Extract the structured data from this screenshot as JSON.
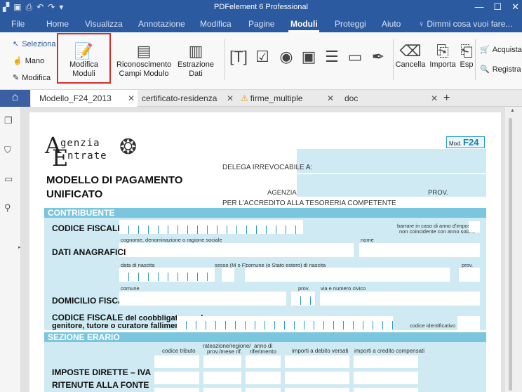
{
  "app": {
    "title": "PDFelement 6 Professional"
  },
  "menu": {
    "items": [
      "File",
      "Home",
      "Visualizza",
      "Annotazione",
      "Modifica",
      "Pagine",
      "Moduli",
      "Proteggi",
      "Aiuto"
    ],
    "tell_me": "Dimmi cosa vuoi fare..."
  },
  "ribbon": {
    "seleziona": "Seleziona",
    "mano": "Mano",
    "modifica": "Modifica",
    "modifica_moduli": "Modifica Moduli",
    "riconoscimento": "Riconoscimento Campi Modulo",
    "estrazione": "Estrazione Dati",
    "cancella": "Cancella",
    "importa": "Importa",
    "esp": "Esp",
    "acquista": "Acquista",
    "registra": "Registra"
  },
  "tabs": [
    "Modello_F24_2013",
    "certificato-residenza",
    "firme_multiple",
    "doc"
  ],
  "form": {
    "logo_line1": "genzia",
    "logo_line2": "ntrate",
    "mod": "Mod.",
    "mod_code": "F24",
    "title1": "MODELLO DI PAGAMENTO",
    "title2": "UNIFICATO",
    "delega": "DELEGA IRREVOCABILE A:",
    "agenzia": "AGENZIA",
    "prov": "PROV.",
    "accredito": "PER L'ACCREDITO ALLA TESORERIA COMPETENTE",
    "contribuente": "CONTRIBUENTE",
    "codice_fiscale": "CODICE FISCALE",
    "barrare1": "barrare in caso di anno d'imposta",
    "barrare2": "non coincidente con anno solare",
    "cognome": "cognome, denominazione o ragione sociale",
    "nome": "nome",
    "dati_anagrafici": "DATI ANAGRAFICI",
    "data_nascita": "data di nascita",
    "giorno": "giorno",
    "mese": "mese",
    "anno": "anno",
    "sesso": "sesso (M o F)",
    "comune_nascita": "comune (o Stato estero) di nascita",
    "prov2": "prov.",
    "comune": "comune",
    "prov3": "prov.",
    "via": "via e numero civico",
    "domicilio": "DOMICILIO FISCALE",
    "coobbligato1": "CODICE FISCALE",
    "coobbligato1b": "del coobbligato, erede,",
    "coobbligato2": "genitore, tutore o curatore fallimentare",
    "codice_ident": "codice identificativo",
    "erario": "SEZIONE ERARIO",
    "codice_tributo": "codice tributo",
    "rateazione": "rateazione/regione/",
    "prov_mese": "prov./mese rif.",
    "anno_di": "anno di",
    "riferimento": "riferimento",
    "debito": "importi a debito versati",
    "credito": "importi a credito compensati",
    "imposte": "IMPOSTE DIRETTE – IVA",
    "ritenute": "RITENUTE ALLA FONTE"
  }
}
